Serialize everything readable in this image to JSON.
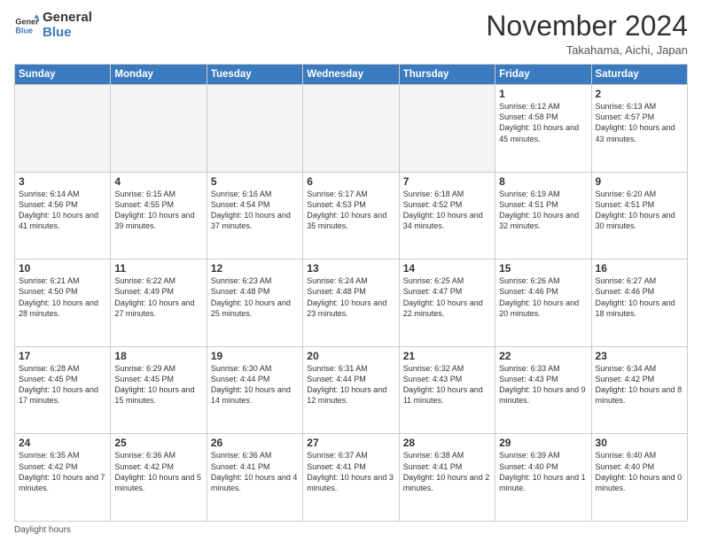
{
  "logo": {
    "line1": "General",
    "line2": "Blue"
  },
  "header": {
    "title": "November 2024",
    "location": "Takahama, Aichi, Japan"
  },
  "days_of_week": [
    "Sunday",
    "Monday",
    "Tuesday",
    "Wednesday",
    "Thursday",
    "Friday",
    "Saturday"
  ],
  "weeks": [
    [
      {
        "day": "",
        "info": ""
      },
      {
        "day": "",
        "info": ""
      },
      {
        "day": "",
        "info": ""
      },
      {
        "day": "",
        "info": ""
      },
      {
        "day": "",
        "info": ""
      },
      {
        "day": "1",
        "info": "Sunrise: 6:12 AM\nSunset: 4:58 PM\nDaylight: 10 hours\nand 45 minutes."
      },
      {
        "day": "2",
        "info": "Sunrise: 6:13 AM\nSunset: 4:57 PM\nDaylight: 10 hours\nand 43 minutes."
      }
    ],
    [
      {
        "day": "3",
        "info": "Sunrise: 6:14 AM\nSunset: 4:56 PM\nDaylight: 10 hours\nand 41 minutes."
      },
      {
        "day": "4",
        "info": "Sunrise: 6:15 AM\nSunset: 4:55 PM\nDaylight: 10 hours\nand 39 minutes."
      },
      {
        "day": "5",
        "info": "Sunrise: 6:16 AM\nSunset: 4:54 PM\nDaylight: 10 hours\nand 37 minutes."
      },
      {
        "day": "6",
        "info": "Sunrise: 6:17 AM\nSunset: 4:53 PM\nDaylight: 10 hours\nand 35 minutes."
      },
      {
        "day": "7",
        "info": "Sunrise: 6:18 AM\nSunset: 4:52 PM\nDaylight: 10 hours\nand 34 minutes."
      },
      {
        "day": "8",
        "info": "Sunrise: 6:19 AM\nSunset: 4:51 PM\nDaylight: 10 hours\nand 32 minutes."
      },
      {
        "day": "9",
        "info": "Sunrise: 6:20 AM\nSunset: 4:51 PM\nDaylight: 10 hours\nand 30 minutes."
      }
    ],
    [
      {
        "day": "10",
        "info": "Sunrise: 6:21 AM\nSunset: 4:50 PM\nDaylight: 10 hours\nand 28 minutes."
      },
      {
        "day": "11",
        "info": "Sunrise: 6:22 AM\nSunset: 4:49 PM\nDaylight: 10 hours\nand 27 minutes."
      },
      {
        "day": "12",
        "info": "Sunrise: 6:23 AM\nSunset: 4:48 PM\nDaylight: 10 hours\nand 25 minutes."
      },
      {
        "day": "13",
        "info": "Sunrise: 6:24 AM\nSunset: 4:48 PM\nDaylight: 10 hours\nand 23 minutes."
      },
      {
        "day": "14",
        "info": "Sunrise: 6:25 AM\nSunset: 4:47 PM\nDaylight: 10 hours\nand 22 minutes."
      },
      {
        "day": "15",
        "info": "Sunrise: 6:26 AM\nSunset: 4:46 PM\nDaylight: 10 hours\nand 20 minutes."
      },
      {
        "day": "16",
        "info": "Sunrise: 6:27 AM\nSunset: 4:46 PM\nDaylight: 10 hours\nand 18 minutes."
      }
    ],
    [
      {
        "day": "17",
        "info": "Sunrise: 6:28 AM\nSunset: 4:45 PM\nDaylight: 10 hours\nand 17 minutes."
      },
      {
        "day": "18",
        "info": "Sunrise: 6:29 AM\nSunset: 4:45 PM\nDaylight: 10 hours\nand 15 minutes."
      },
      {
        "day": "19",
        "info": "Sunrise: 6:30 AM\nSunset: 4:44 PM\nDaylight: 10 hours\nand 14 minutes."
      },
      {
        "day": "20",
        "info": "Sunrise: 6:31 AM\nSunset: 4:44 PM\nDaylight: 10 hours\nand 12 minutes."
      },
      {
        "day": "21",
        "info": "Sunrise: 6:32 AM\nSunset: 4:43 PM\nDaylight: 10 hours\nand 11 minutes."
      },
      {
        "day": "22",
        "info": "Sunrise: 6:33 AM\nSunset: 4:43 PM\nDaylight: 10 hours\nand 9 minutes."
      },
      {
        "day": "23",
        "info": "Sunrise: 6:34 AM\nSunset: 4:42 PM\nDaylight: 10 hours\nand 8 minutes."
      }
    ],
    [
      {
        "day": "24",
        "info": "Sunrise: 6:35 AM\nSunset: 4:42 PM\nDaylight: 10 hours\nand 7 minutes."
      },
      {
        "day": "25",
        "info": "Sunrise: 6:36 AM\nSunset: 4:42 PM\nDaylight: 10 hours\nand 5 minutes."
      },
      {
        "day": "26",
        "info": "Sunrise: 6:36 AM\nSunset: 4:41 PM\nDaylight: 10 hours\nand 4 minutes."
      },
      {
        "day": "27",
        "info": "Sunrise: 6:37 AM\nSunset: 4:41 PM\nDaylight: 10 hours\nand 3 minutes."
      },
      {
        "day": "28",
        "info": "Sunrise: 6:38 AM\nSunset: 4:41 PM\nDaylight: 10 hours\nand 2 minutes."
      },
      {
        "day": "29",
        "info": "Sunrise: 6:39 AM\nSunset: 4:40 PM\nDaylight: 10 hours\nand 1 minute."
      },
      {
        "day": "30",
        "info": "Sunrise: 6:40 AM\nSunset: 4:40 PM\nDaylight: 10 hours\nand 0 minutes."
      }
    ]
  ],
  "footer": {
    "note": "Daylight hours"
  }
}
